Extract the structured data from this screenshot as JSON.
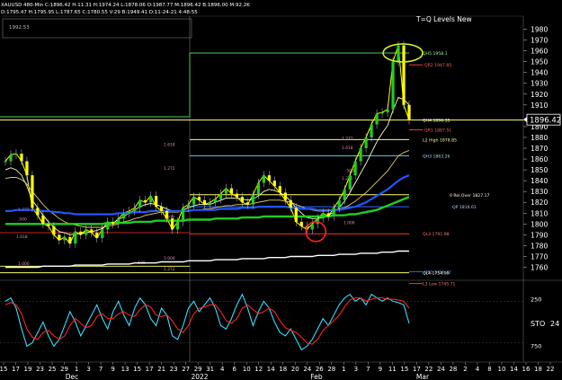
{
  "header": {
    "info_line1": "XAUUSD  480-Min  C:1896.42  H:11.31  H:1974.24  L:1878.06  O:1987.77  M:1896.42  B:1896.00  M:92.2K",
    "info_line2": "D:1795.47  H:1795.95  L:1787.65  C:1780.55  V:29  B:1949.41  D:11-24-21  4:48:55",
    "corner_value": "1992.53",
    "study_title": "T=Q Levels New"
  },
  "colors": {
    "background": "#000000",
    "price_bars": "#ffff00",
    "level_green": "#55cc55",
    "level_yellow": "#ffff66",
    "level_red": "#ff3333",
    "level_cyan": "#66ccff",
    "level_blue": "#3366ff",
    "ma_blue": "#2255ff",
    "ma_green": "#22cc22",
    "ma_white": "#ffffff",
    "ma_yellow": "#ffff00",
    "sto_cyan": "#33ddff",
    "sto_red": "#ff2222",
    "annotation_ellipse": "#ccee33",
    "annotation_circle": "#ff2222",
    "current_price_box": "#ffffff"
  },
  "chart_data": [
    {
      "type": "line",
      "name": "price_panel",
      "y_axis_ticks": [
        1980,
        1970,
        1960,
        1950,
        1940,
        1930,
        1920,
        1910,
        1890,
        1880,
        1870,
        1860,
        1850,
        1840,
        1830,
        1820,
        1810,
        1800,
        1790,
        1780,
        1770,
        1760
      ],
      "ylim": [
        1748,
        1992
      ],
      "current_price": "1896.42",
      "x_tick_labels": [
        "15",
        "17",
        "19",
        "23",
        "25",
        "29",
        "1",
        "3",
        "7",
        "9",
        "13",
        "15",
        "17",
        "21",
        "23",
        "27",
        "29",
        "31",
        "4",
        "6",
        "10",
        "12",
        "14",
        "18",
        "20",
        "24",
        "26",
        "28",
        "1",
        "3",
        "7",
        "9",
        "11",
        "15",
        "17",
        "22",
        "24",
        "28",
        "2",
        "4",
        "8",
        "10",
        "14",
        "16",
        "18",
        "22"
      ],
      "month_labels": [
        "Dec",
        "2022",
        "Feb",
        "Mar"
      ],
      "series": [
        {
          "name": "price",
          "values": [
            1858,
            1864,
            1865,
            1858,
            1845,
            1815,
            1808,
            1800,
            1798,
            1790,
            1785,
            1788,
            1782,
            1793,
            1790,
            1795,
            1792,
            1787,
            1795,
            1802,
            1800,
            1805,
            1810,
            1812,
            1815,
            1822,
            1820,
            1826,
            1816,
            1812,
            1805,
            1795,
            1802,
            1815,
            1818,
            1825,
            1822,
            1818,
            1820,
            1823,
            1828,
            1833,
            1828,
            1825,
            1820,
            1818,
            1827,
            1838,
            1845,
            1840,
            1835,
            1829,
            1822,
            1815,
            1802,
            1798,
            1795,
            1800,
            1805,
            1810,
            1807,
            1815,
            1822,
            1832,
            1845,
            1858,
            1870,
            1880,
            1892,
            1902,
            1903,
            1906,
            1950,
            1965,
            1910,
            1896
          ]
        },
        {
          "name": "MA fast",
          "values": [
            1850,
            1852,
            1850,
            1845,
            1835,
            1822,
            1815,
            1808,
            1802,
            1797,
            1793,
            1792,
            1790,
            1791,
            1791,
            1792,
            1793,
            1794,
            1796,
            1799,
            1801,
            1804,
            1807,
            1810,
            1813,
            1816,
            1818,
            1819,
            1818,
            1816,
            1814,
            1812,
            1812,
            1813,
            1815,
            1817,
            1818,
            1818,
            1818,
            1820,
            1822,
            1824,
            1824,
            1824,
            1823,
            1822,
            1823,
            1826,
            1830,
            1832,
            1831,
            1829,
            1826,
            1821,
            1815,
            1810,
            1806,
            1805,
            1805,
            1806,
            1808,
            1811,
            1815,
            1821,
            1829,
            1838,
            1847,
            1856,
            1866,
            1876,
            1884,
            1891,
            1905,
            1917,
            1915,
            1910
          ]
        },
        {
          "name": "MA slow",
          "values": [
            1842,
            1843,
            1843,
            1841,
            1837,
            1830,
            1824,
            1818,
            1813,
            1809,
            1805,
            1802,
            1800,
            1799,
            1798,
            1797,
            1797,
            1797,
            1797,
            1798,
            1799,
            1800,
            1802,
            1803,
            1805,
            1806,
            1808,
            1809,
            1810,
            1811,
            1811,
            1811,
            1811,
            1812,
            1812,
            1813,
            1813,
            1814,
            1814,
            1815,
            1816,
            1817,
            1817,
            1818,
            1818,
            1818,
            1819,
            1820,
            1821,
            1822,
            1822,
            1822,
            1821,
            1820,
            1818,
            1816,
            1814,
            1813,
            1812,
            1812,
            1812,
            1813,
            1814,
            1815,
            1818,
            1821,
            1825,
            1829,
            1834,
            1839,
            1844,
            1849,
            1856,
            1863,
            1866,
            1868
          ]
        },
        {
          "name": "MA blue",
          "values": [
            1812,
            1812,
            1813,
            1813,
            1813,
            1813,
            1813,
            1812,
            1812,
            1811,
            1811,
            1810,
            1810,
            1809,
            1809,
            1809,
            1809,
            1809,
            1809,
            1809,
            1809,
            1810,
            1810,
            1810,
            1811,
            1811,
            1811,
            1812,
            1812,
            1812,
            1812,
            1812,
            1812,
            1812,
            1812,
            1813,
            1813,
            1813,
            1813,
            1813,
            1814,
            1814,
            1814,
            1814,
            1815,
            1815,
            1815,
            1816,
            1816,
            1816,
            1816,
            1816,
            1816,
            1815,
            1815,
            1814,
            1814,
            1814,
            1813,
            1813,
            1813,
            1813,
            1813,
            1814,
            1815,
            1816,
            1818,
            1820,
            1823,
            1826,
            1829,
            1832,
            1836,
            1840,
            1843,
            1845
          ]
        },
        {
          "name": "MA green",
          "values": [
            1800,
            1800,
            1800,
            1800,
            1800,
            1800,
            1800,
            1800,
            1800,
            1800,
            1800,
            1800,
            1800,
            1800,
            1800,
            1800,
            1800,
            1800,
            1800,
            1801,
            1801,
            1801,
            1801,
            1801,
            1802,
            1802,
            1802,
            1802,
            1803,
            1803,
            1803,
            1803,
            1803,
            1803,
            1804,
            1804,
            1804,
            1804,
            1804,
            1805,
            1805,
            1805,
            1805,
            1805,
            1806,
            1806,
            1806,
            1806,
            1807,
            1807,
            1807,
            1807,
            1807,
            1807,
            1807,
            1807,
            1807,
            1807,
            1807,
            1807,
            1807,
            1808,
            1808,
            1808,
            1809,
            1809,
            1810,
            1811,
            1812,
            1813,
            1815,
            1817,
            1819,
            1821,
            1823,
            1825
          ]
        },
        {
          "name": "MA white",
          "values": [
            1760,
            1760,
            1760,
            1760,
            1760,
            1760,
            1760,
            1761,
            1761,
            1761,
            1761,
            1761,
            1761,
            1762,
            1762,
            1762,
            1762,
            1762,
            1762,
            1763,
            1763,
            1763,
            1763,
            1763,
            1764,
            1764,
            1764,
            1764,
            1764,
            1765,
            1765,
            1765,
            1765,
            1765,
            1766,
            1766,
            1766,
            1766,
            1766,
            1767,
            1767,
            1767,
            1767,
            1767,
            1768,
            1768,
            1768,
            1768,
            1768,
            1769,
            1769,
            1769,
            1769,
            1770,
            1770,
            1770,
            1770,
            1770,
            1771,
            1771,
            1771,
            1771,
            1772,
            1772,
            1772,
            1772,
            1773,
            1773,
            1773,
            1773,
            1774,
            1774,
            1774,
            1775,
            1775,
            1775
          ]
        }
      ],
      "levels": [
        {
          "label": "QH5 1958.1",
          "value": 1958
        },
        {
          "label": "QR2 1947.85",
          "value": 1947
        },
        {
          "label": "QH4 1896.35",
          "value": 1896
        },
        {
          "label": "QR1 1887.51",
          "value": 1887
        },
        {
          "label": "L2 High 1878.85",
          "value": 1878
        },
        {
          "label": "QH3 1863.26",
          "value": 1863
        },
        {
          "label": "0 Rel.Over 1827.17",
          "value": 1827
        },
        {
          "label": "QP 1816.61",
          "value": 1816
        },
        {
          "label": "QL3 1791.98",
          "value": 1791
        },
        {
          "label": "QS1 1756.22",
          "value": 1756
        },
        {
          "label": "QL4 1754.99",
          "value": 1755
        },
        {
          "label": "L3 Low 1745.71",
          "value": 1745
        }
      ],
      "fib_labels": [
        "1.272",
        "1.618",
        ".500",
        "1.000",
        "1.272",
        "1.618",
        ".500",
        "1.000",
        "1.272",
        "1.272",
        "1.618",
        "1.272",
        ".500",
        "1.000",
        "1.272"
      ]
    },
    {
      "type": "line",
      "name": "STO",
      "label": "STO",
      "value_label": "24",
      "y_axis_ticks": [
        "250",
        "750"
      ],
      "ylim": [
        0,
        100
      ],
      "series": [
        {
          "name": "%K",
          "values": [
            80,
            85,
            70,
            40,
            15,
            20,
            35,
            50,
            30,
            15,
            25,
            45,
            65,
            50,
            30,
            45,
            60,
            75,
            55,
            40,
            65,
            80,
            60,
            45,
            70,
            85,
            75,
            55,
            45,
            70,
            60,
            30,
            25,
            45,
            70,
            80,
            65,
            75,
            85,
            70,
            45,
            40,
            55,
            75,
            90,
            70,
            45,
            65,
            80,
            70,
            50,
            35,
            30,
            40,
            25,
            10,
            15,
            25,
            40,
            55,
            45,
            60,
            75,
            85,
            90,
            80,
            85,
            75,
            90,
            85,
            80,
            85,
            80,
            78,
            75,
            48
          ]
        },
        {
          "name": "%D",
          "values": [
            75,
            78,
            75,
            62,
            40,
            28,
            25,
            35,
            38,
            30,
            25,
            30,
            45,
            55,
            48,
            42,
            45,
            58,
            62,
            55,
            55,
            62,
            65,
            60,
            58,
            68,
            75,
            72,
            60,
            58,
            60,
            52,
            40,
            35,
            45,
            62,
            70,
            72,
            75,
            75,
            65,
            52,
            48,
            55,
            70,
            75,
            68,
            62,
            65,
            70,
            65,
            52,
            42,
            38,
            35,
            28,
            20,
            18,
            25,
            38,
            45,
            52,
            60,
            72,
            82,
            85,
            85,
            80,
            83,
            85,
            85,
            83,
            83,
            82,
            80,
            70
          ]
        }
      ]
    }
  ]
}
